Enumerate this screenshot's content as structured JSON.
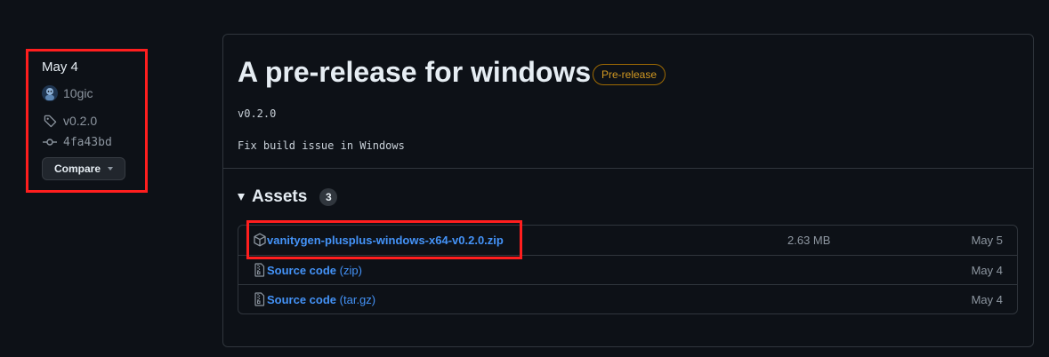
{
  "sidebar": {
    "date": "May 4",
    "author": "10gic",
    "tag": "v0.2.0",
    "commit": "4fa43bd",
    "compare_label": "Compare"
  },
  "release": {
    "title": "A pre-release for windows",
    "badge": "Pre-release",
    "tag": "v0.2.0",
    "notes": "Fix build issue in Windows"
  },
  "assets": {
    "label": "Assets",
    "count": "3",
    "items": [
      {
        "name": "vanitygen-plusplus-windows-x64-v0.2.0.zip",
        "size": "2.63 MB",
        "date": "May 5",
        "icon": "package-icon"
      },
      {
        "name": "Source code",
        "suffix": "(zip)",
        "size": "",
        "date": "May 4",
        "icon": "file-zip-icon"
      },
      {
        "name": "Source code",
        "suffix": "(tar.gz)",
        "size": "",
        "date": "May 4",
        "icon": "file-zip-icon"
      }
    ]
  },
  "colors": {
    "background": "#0d1117",
    "link": "#4493f8",
    "badge": "#d29922",
    "highlight": "#ff1e1e"
  }
}
